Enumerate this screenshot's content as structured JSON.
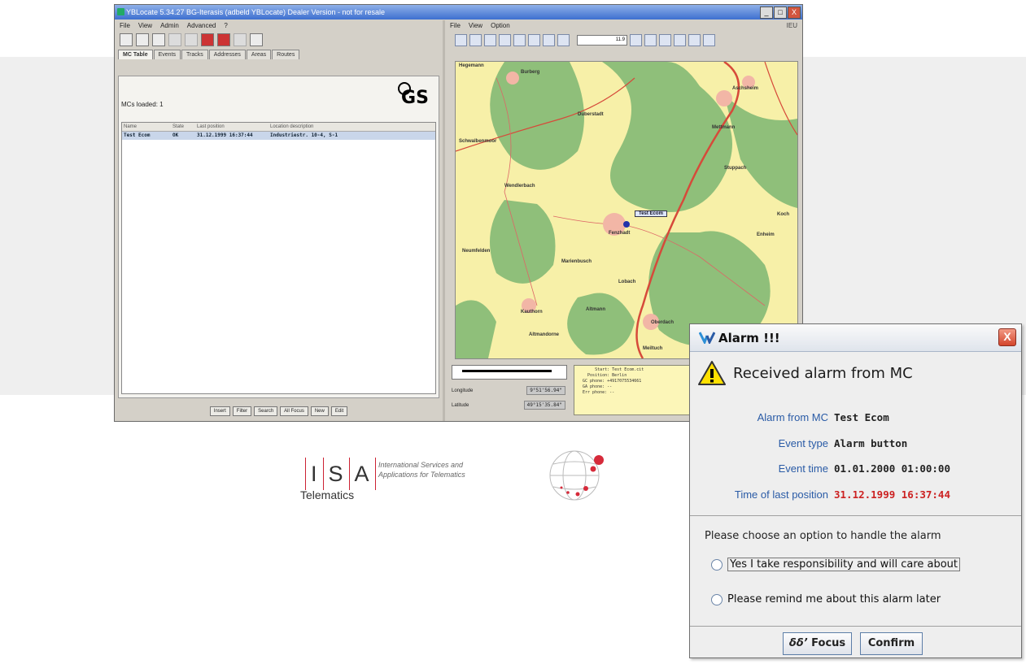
{
  "window": {
    "title": "YBLocate 5.34.27 BG-Iterasis (adbeld YBLocate) Dealer Version - not for resale",
    "min": "_",
    "max": "□",
    "close": "X"
  },
  "left": {
    "menu": [
      "File",
      "View",
      "Admin",
      "Advanced",
      "?"
    ],
    "tabs": [
      "MC Table",
      "Events",
      "Tracks",
      "Addresses",
      "Areas",
      "Routes"
    ],
    "loaded": "MCs loaded: 1",
    "logo": "GS",
    "table": {
      "headers": [
        "Name",
        "State",
        "Last position",
        "Location description"
      ],
      "rows": [
        [
          "Test Ecom",
          "OK",
          "31.12.1999 16:37:44",
          "Industriestr. 10-4, S-1"
        ]
      ]
    },
    "buttons": [
      "Insert",
      "Filter",
      "Search",
      "All Focus",
      "New",
      "Edit"
    ]
  },
  "right": {
    "menu": [
      "File",
      "View",
      "Option"
    ],
    "menu_right": "IEU",
    "zoom": "11.9",
    "map": {
      "places": [
        "Hegemann",
        "Burberg",
        "Aschsheim",
        "Schwalbenmoor",
        "Duberstadt",
        "Mettmann",
        "Stuppach",
        "Wendlerbach",
        "Fenzhadt",
        "Neumfelden",
        "Marienbusch",
        "Enheim",
        "Lobach",
        "Kauthorn",
        "Altmann",
        "Altmandorne",
        "Oberdach",
        "Meiltuch",
        "Koch"
      ],
      "vehicle": "Test Ecom"
    },
    "longitude_label": "Longitude",
    "longitude": "9°51'56.94\"",
    "latitude_label": "Latitude",
    "latitude": "49°15'35.84\"",
    "status": "       Start: Test Ecom.cit\n    Position: Berlin\n  GC phone: +4917075534661\n  GA phone: --\n  Err phone: --"
  },
  "branding": {
    "isa_letters": [
      "I",
      "S",
      "A"
    ],
    "isa_sub": "Telematics",
    "isa_tagline_1": "International Services and",
    "isa_tagline_2": "Applications for Telematics"
  },
  "dialog": {
    "title": "Alarm !!!",
    "close": "X",
    "heading": "Received alarm from MC",
    "fields": [
      {
        "label": "Alarm from MC",
        "value": "Test Ecom"
      },
      {
        "label": "Event type",
        "value": "Alarm button"
      },
      {
        "label": "Event time",
        "value": "01.01.2000 01:00:00"
      },
      {
        "label": "Time of last position",
        "value": "31.12.1999 16:37:44"
      }
    ],
    "prompt": "Please choose an option to handle the alarm",
    "option1": "Yes I take responsibility and will care about",
    "option2": "Please remind me about this alarm later",
    "focus_btn": "Focus",
    "confirm_btn": "Confirm",
    "colors": {
      "label": "#2a5ba6",
      "alert": "#c22222"
    }
  }
}
